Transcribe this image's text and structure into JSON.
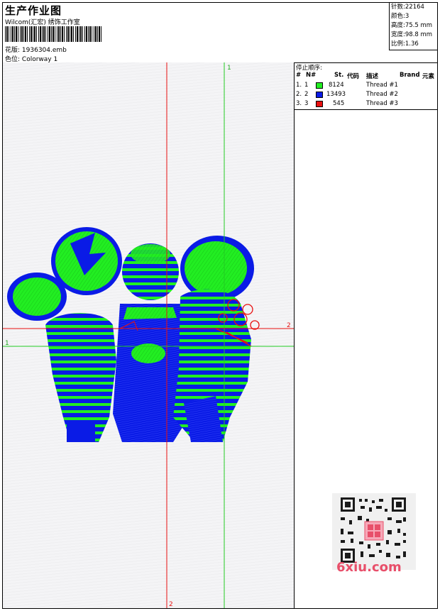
{
  "header": {
    "title": "生产作业图",
    "company": "Wilcom(汇宏) 绣饰工作室",
    "design_label": "花版:",
    "design_value": "1936304.emb",
    "colorway_label": "色位:",
    "colorway_value": "Colorway 1"
  },
  "stats": [
    {
      "label": "针数:",
      "value": "22164"
    },
    {
      "label": "颜色:",
      "value": "3"
    },
    {
      "label": "高度:",
      "value": "75.5 mm"
    },
    {
      "label": "宽度:",
      "value": "98.8 mm"
    },
    {
      "label": "比例:",
      "value": "1.36"
    }
  ],
  "thread_panel": {
    "title": "停止顺序:",
    "columns": {
      "num": "#",
      "n": "N#",
      "st": "St.",
      "code": "代码",
      "desc": "描述",
      "brand": "Brand",
      "element": "元素"
    },
    "rows": [
      {
        "index": "1.",
        "n": "1",
        "color": "#22ee22",
        "stitches": "8124",
        "desc": "Thread #1"
      },
      {
        "index": "2.",
        "n": "2",
        "color": "#0a1be6",
        "stitches": "13493",
        "desc": "Thread #2"
      },
      {
        "index": "3.",
        "n": "3",
        "color": "#e81010",
        "stitches": "545",
        "desc": "Thread #3"
      }
    ]
  },
  "guides": {
    "vertical_red_label": "2",
    "vertical_green_label": "1",
    "horizontal_green_label": "1",
    "horizontal_red_label": "2",
    "red": "#e81010",
    "green": "#22cc22"
  },
  "watermark": {
    "text": "6xiu.com",
    "color": "#e84f6a"
  }
}
